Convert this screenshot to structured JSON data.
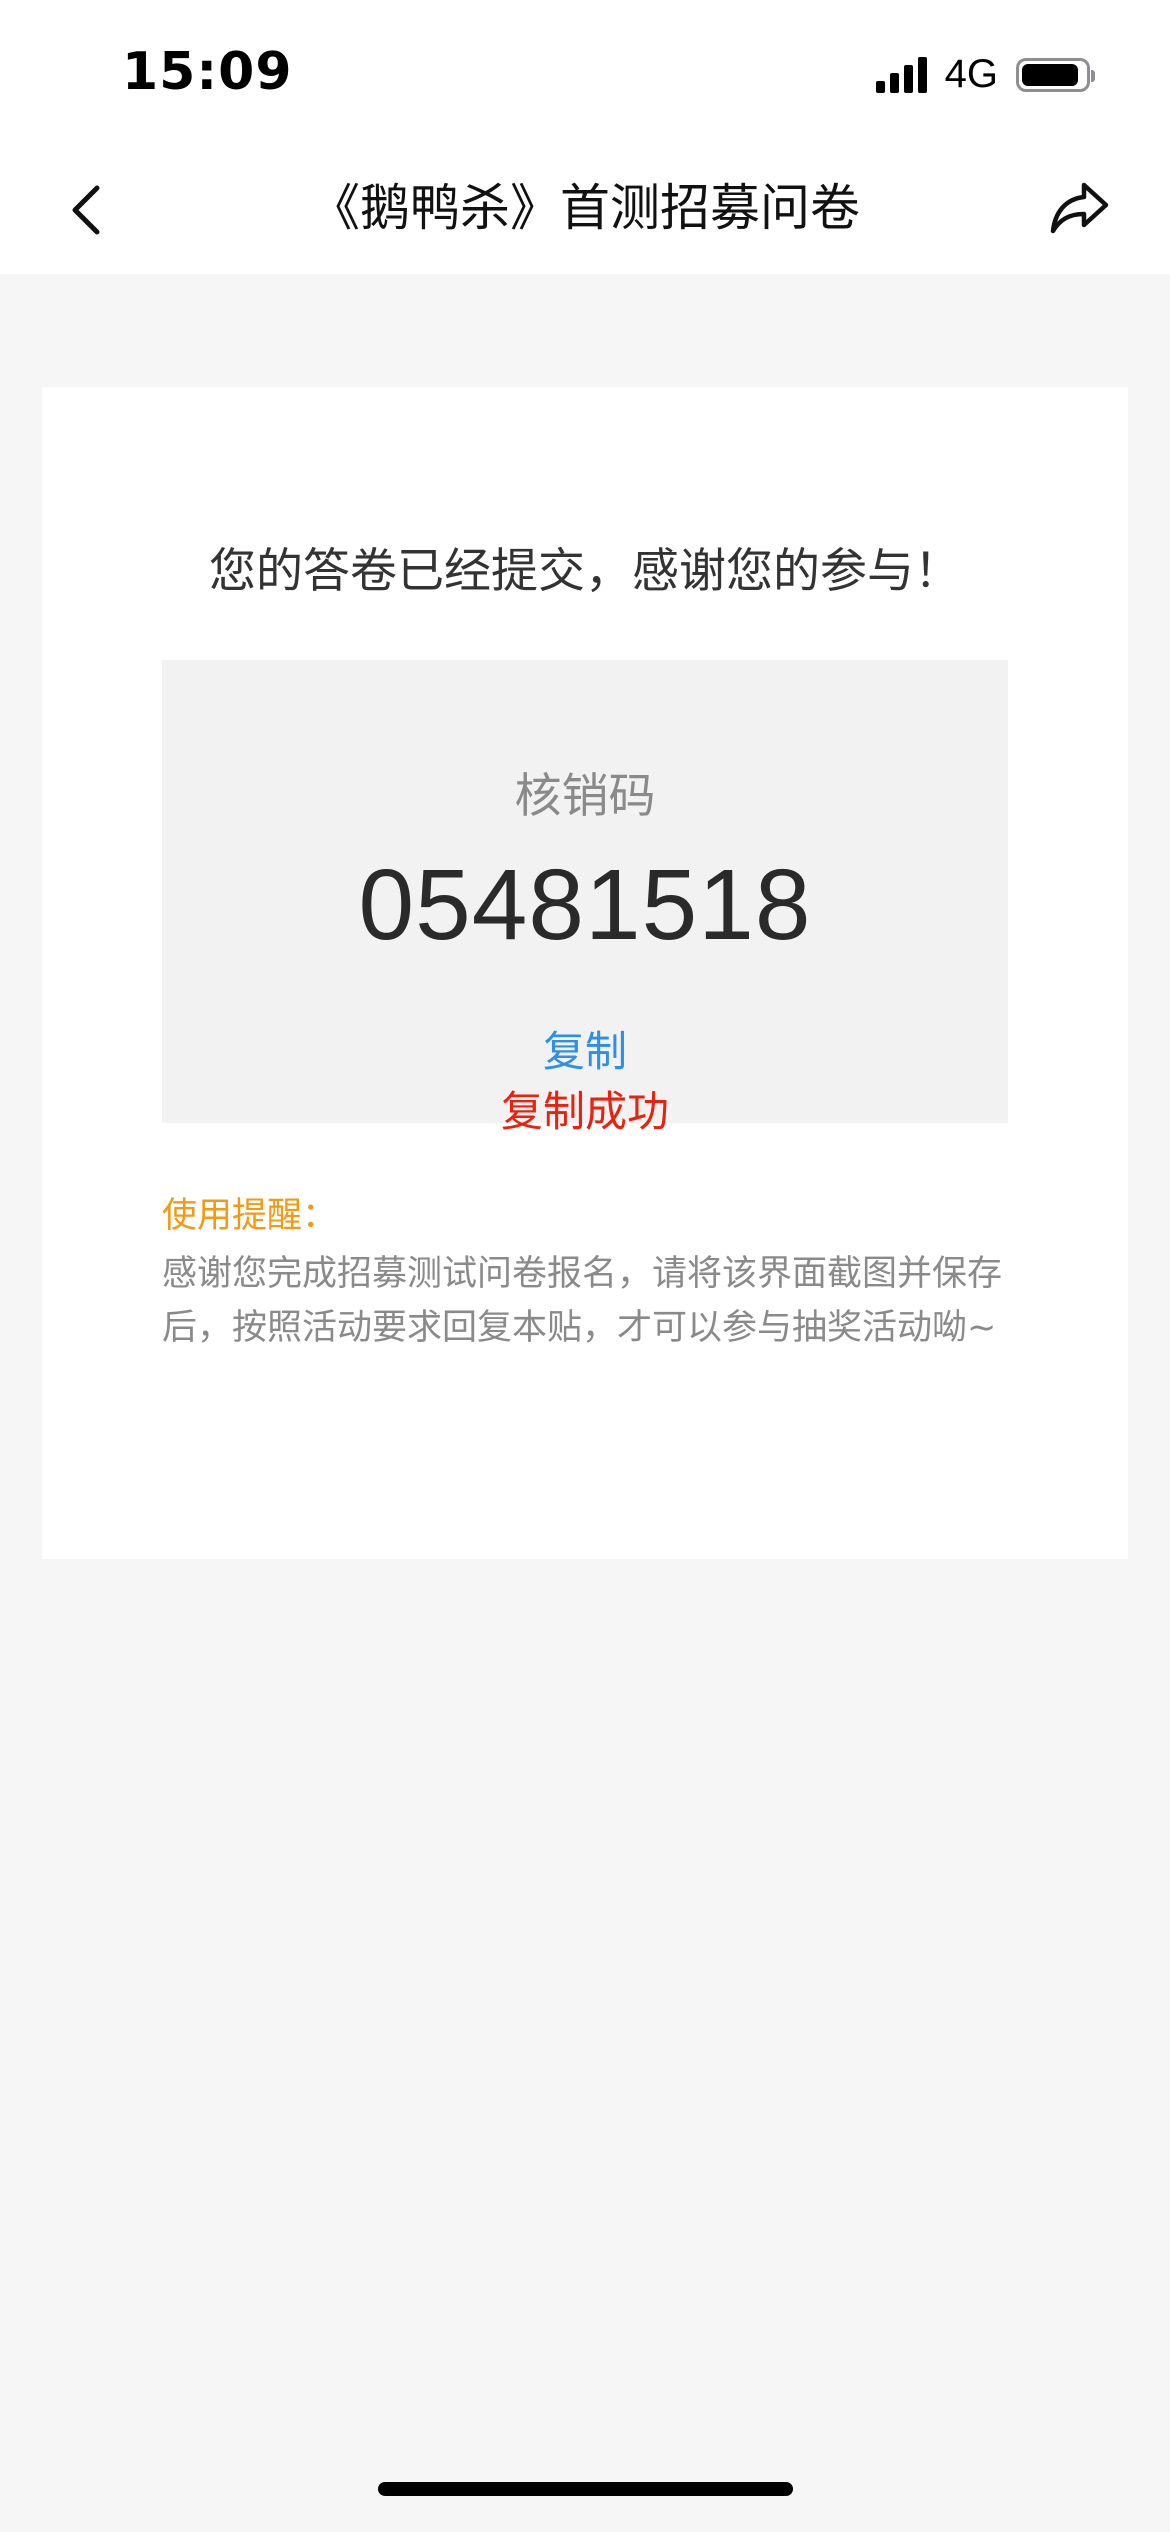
{
  "status_bar": {
    "time": "15:09",
    "network": "4G",
    "battery_level": 0.9
  },
  "nav": {
    "title": "《鹅鸭杀》首测招募问卷",
    "back_icon": "chevron-left-icon",
    "share_icon": "share-icon"
  },
  "main": {
    "success_message": "您的答卷已经提交，感谢您的参与！",
    "code": {
      "label": "核销码",
      "value": "05481518",
      "copy_label": "复制",
      "copy_status": "复制成功"
    },
    "tips": {
      "title": "使用提醒：",
      "body": "感谢您完成招募测试问卷报名，请将该界面截图并保存后，按照活动要求回复本贴，才可以参与抽奖活动呦~"
    }
  },
  "colors": {
    "accent_link": "#2f8fe6",
    "success_red": "#e8220f",
    "tip_orange": "#f39a14",
    "background": "#f6f6f6"
  }
}
